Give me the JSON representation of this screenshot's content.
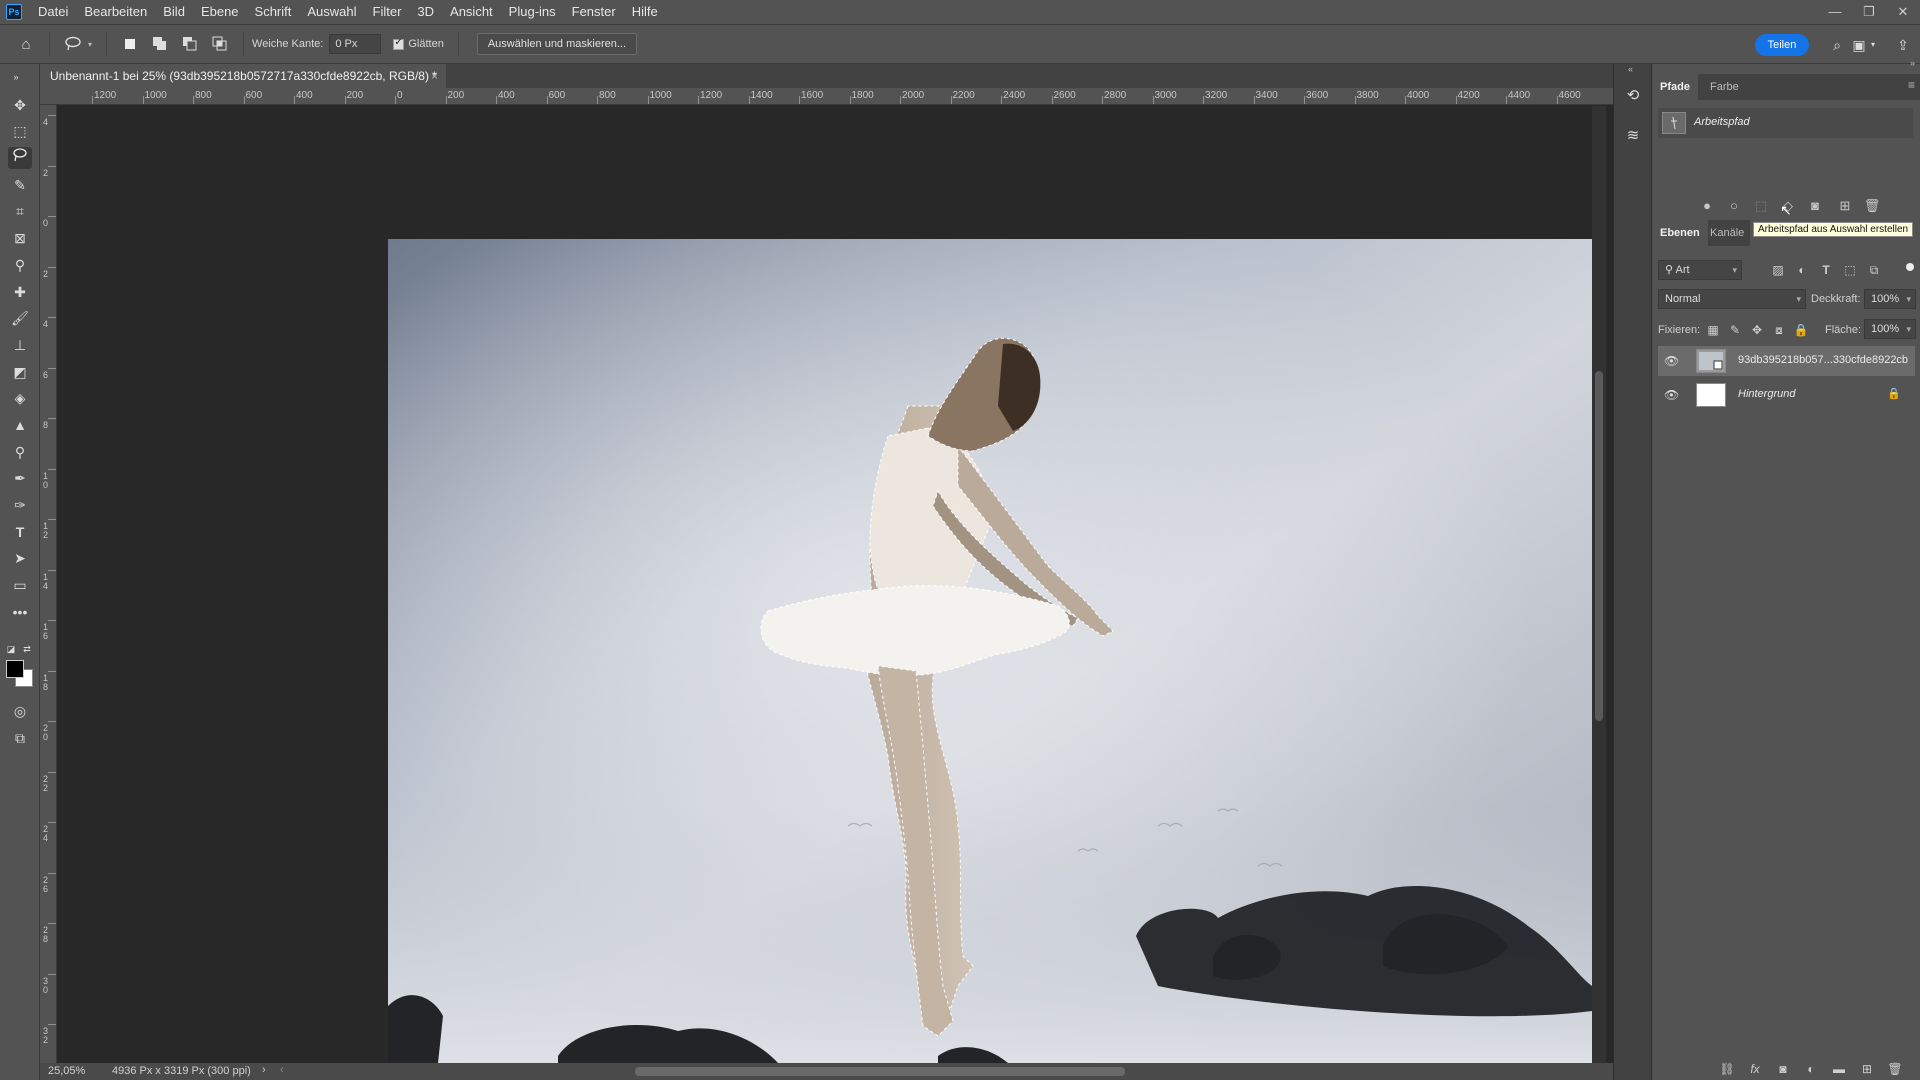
{
  "app": {
    "logo_text": "Ps"
  },
  "menu": {
    "items": [
      "Datei",
      "Bearbeiten",
      "Bild",
      "Ebene",
      "Schrift",
      "Auswahl",
      "Filter",
      "3D",
      "Ansicht",
      "Plug-ins",
      "Fenster",
      "Hilfe"
    ]
  },
  "options_bar": {
    "feather_label": "Weiche Kante:",
    "feather_value": "0 Px",
    "antialias_label": "Glätten",
    "select_mask_label": "Auswählen und maskieren...",
    "share_label": "Teilen"
  },
  "document": {
    "tab_title": "Unbenannt-1 bei 25% (93db395218b0572717a330cfde8922cb, RGB/8) *",
    "close_glyph": "×"
  },
  "rulers": {
    "top_labels": [
      "1200",
      "1000",
      "800",
      "600",
      "400",
      "200",
      "0",
      "200",
      "400",
      "600",
      "800",
      "1000",
      "1200",
      "1400",
      "1600",
      "1800",
      "2000",
      "2200",
      "2400",
      "2600",
      "2800",
      "3000",
      "3200",
      "3400",
      "3600",
      "3800",
      "4000",
      "4200",
      "4400",
      "4600"
    ],
    "left_labels": [
      "4",
      "2",
      "0",
      "2",
      "4",
      "6",
      "8",
      "1 0",
      "1 2",
      "1 4",
      "1 6",
      "1 8",
      "2 0",
      "2 2",
      "2 4",
      "2 6",
      "2 8",
      "3 0",
      "3 2"
    ]
  },
  "status": {
    "zoom": "25,05%",
    "doc_info": "4936 Px x 3319 Px (300 ppi)"
  },
  "panels": {
    "paths_tabs": [
      "Pfade",
      "Farbe"
    ],
    "paths": [
      {
        "name": "Arbeitspfad"
      }
    ],
    "tooltip": "Arbeitspfad aus Auswahl erstellen",
    "layers_tabs": [
      "Ebenen",
      "Kanäle"
    ],
    "filter_kind": "Art",
    "blend_mode": "Normal",
    "opacity_label": "Deckkraft:",
    "opacity_value": "100%",
    "lock_label": "Fixieren:",
    "fill_label": "Fläche:",
    "fill_value": "100%",
    "layers": [
      {
        "name": "93db395218b057...330cfde8922cb",
        "visible": true,
        "selected": true
      },
      {
        "name": "Hintergrund",
        "visible": true,
        "selected": false,
        "locked": true
      }
    ]
  },
  "colors": {
    "share_button": "#1473e6",
    "foreground": "#000000",
    "background": "#ffffff"
  }
}
